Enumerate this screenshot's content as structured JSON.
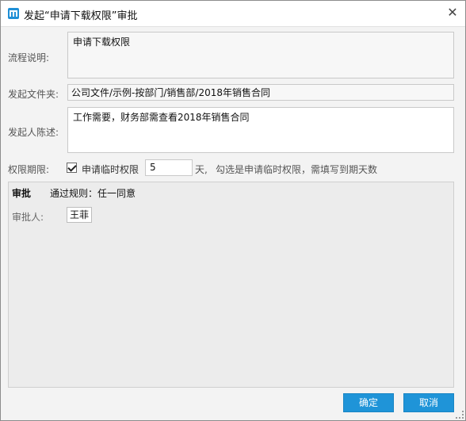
{
  "window": {
    "title": "发起“申请下载权限”审批",
    "close_glyph": "✕"
  },
  "form": {
    "process_desc_label": "流程说明:",
    "process_desc_value": "申请下载权限",
    "folder_label": "发起文件夹:",
    "folder_value": "公司文件/示例-按部门/销售部/2018年销售合同",
    "statement_label": "发起人陈述:",
    "statement_value": "工作需要，财务部需查看2018年销售合同",
    "period_label": "权限期限:",
    "temp_permission_label": "申请临时权限",
    "temp_permission_checked": true,
    "days_value": "5",
    "days_unit": "天,",
    "hint": "勾选是申请临时权限，需填写到期天数"
  },
  "approval": {
    "header": "审批",
    "rule": "通过规则：任一同意",
    "approver_label": "审批人:",
    "approver_name": "王菲"
  },
  "buttons": {
    "confirm": "确定",
    "cancel": "取消"
  },
  "colors": {
    "accent": "#1f94d8",
    "logo": "#1f8fd6"
  }
}
